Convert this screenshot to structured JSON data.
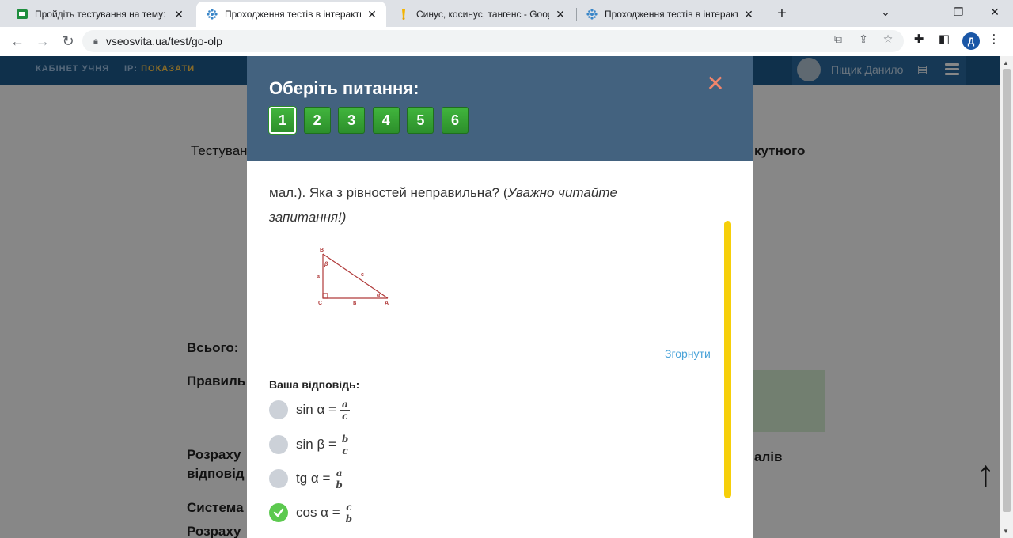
{
  "browser": {
    "tabs": [
      {
        "title": "Пройдіть тестування на тему: С",
        "icon": "classroom-icon",
        "active": false
      },
      {
        "title": "Проходження тестів в інтеракти",
        "icon": "vseosvita-icon",
        "active": true
      },
      {
        "title": "Синус, косинус, тангенс - Googl",
        "icon": "google-icon",
        "active": false
      },
      {
        "title": "Проходження тестів в інтеракти",
        "icon": "vseosvita-icon",
        "active": false
      }
    ],
    "url": "vseosvita.ua/test/go-olp",
    "profile_initial": "Д"
  },
  "site": {
    "cabinet": "КАБІНЕТ УЧНЯ",
    "ip_label": "IP:",
    "ip_show": "ПОКАЗАТИ",
    "user_name": "Піщик Данило"
  },
  "background": {
    "line1_left": "Тестуван",
    "line1_right": "кутного",
    "total": "Всього:",
    "correct": "Правиль",
    "calc1": "Розраху",
    "calc1b": "відповід",
    "calc_right": "алів",
    "system": "Система",
    "calc2": "Розраху"
  },
  "modal": {
    "title": "Оберіть питання:",
    "close": "✕",
    "question_numbers": [
      "1",
      "2",
      "3",
      "4",
      "5",
      "6"
    ],
    "current_question": 1,
    "question_text": "мал.). Яка з рівностей неправильна? (",
    "question_note": "Уважно читайте запитання!)",
    "figure_labels": {
      "B": "B",
      "a": "a",
      "beta": "β",
      "c": "c",
      "C": "C",
      "b": "в",
      "A": "A",
      "alpha": "α"
    },
    "collapse": "Згорнути",
    "answer_label": "Ваша відповідь:",
    "options": [
      {
        "text": "sin α =",
        "num": "a",
        "den": "c",
        "selected": false
      },
      {
        "text": "sin β =",
        "num": "b",
        "den": "c",
        "selected": false
      },
      {
        "text": "tg α =",
        "num": "a",
        "den": "b",
        "selected": false
      },
      {
        "text": "cos α =",
        "num": "c",
        "den": "b",
        "selected": true
      }
    ]
  },
  "colors": {
    "header_blue": "#43627f",
    "button_green": "#2c8f2b",
    "close_orange": "#f2856b",
    "scroll_yellow": "#f6cf0a",
    "link_blue": "#4aa3d9"
  }
}
